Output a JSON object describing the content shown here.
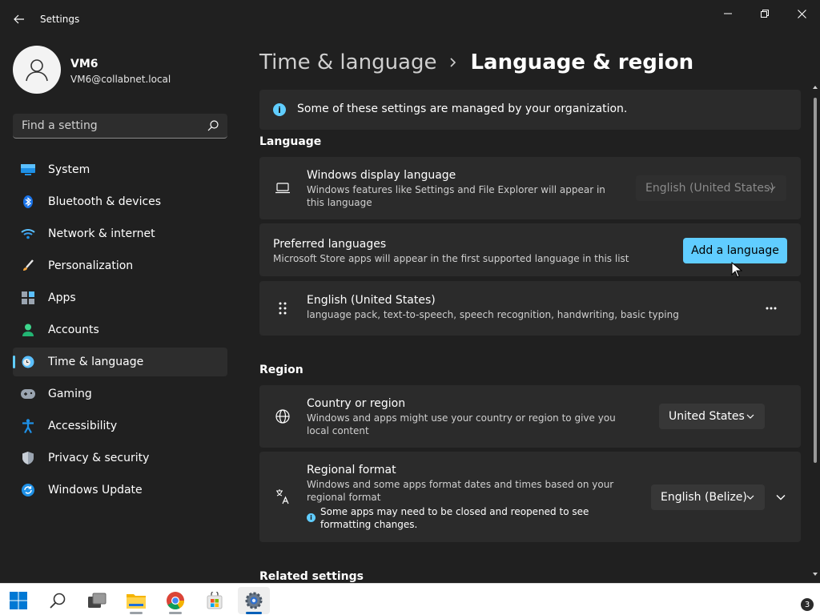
{
  "window": {
    "title": "Settings"
  },
  "profile": {
    "name": "VM6",
    "email": "VM6@collabnet.local"
  },
  "search": {
    "placeholder": "Find a setting",
    "value": ""
  },
  "sidebar": {
    "items": [
      {
        "label": "System",
        "icon": "monitor-icon"
      },
      {
        "label": "Bluetooth & devices",
        "icon": "bluetooth-icon"
      },
      {
        "label": "Network & internet",
        "icon": "wifi-icon"
      },
      {
        "label": "Personalization",
        "icon": "brush-icon"
      },
      {
        "label": "Apps",
        "icon": "apps-icon"
      },
      {
        "label": "Accounts",
        "icon": "person-icon"
      },
      {
        "label": "Time & language",
        "icon": "clock-globe-icon",
        "selected": true
      },
      {
        "label": "Gaming",
        "icon": "gamepad-icon"
      },
      {
        "label": "Accessibility",
        "icon": "accessibility-icon"
      },
      {
        "label": "Privacy & security",
        "icon": "shield-icon"
      },
      {
        "label": "Windows Update",
        "icon": "update-icon"
      }
    ]
  },
  "breadcrumb": {
    "parent": "Time & language",
    "current": "Language & region"
  },
  "info": {
    "text": "Some of these settings are managed by your organization."
  },
  "language": {
    "section_title": "Language",
    "display_language": {
      "title": "Windows display language",
      "description": "Windows features like Settings and File Explorer will appear in this language",
      "value": "English (United States)"
    },
    "preferred": {
      "title": "Preferred languages",
      "description": "Microsoft Store apps will appear in the first supported language in this list",
      "button": "Add a language"
    },
    "installed": {
      "title": "English (United States)",
      "description": "language pack, text-to-speech, speech recognition, handwriting, basic typing",
      "more": "..."
    }
  },
  "region": {
    "section_title": "Region",
    "country": {
      "title": "Country or region",
      "description": "Windows and apps might use your country or region to give you local content",
      "value": "United States"
    },
    "format": {
      "title": "Regional format",
      "description": "Windows and some apps format dates and times based on your regional format",
      "note": "Some apps may need to be closed and reopened to see formatting changes.",
      "value": "English (Belize)"
    }
  },
  "related": {
    "title": "Related settings"
  },
  "taskbar": {
    "items": [
      "windows-start-icon",
      "search-icon",
      "task-view-icon",
      "file-explorer-icon",
      "chrome-icon",
      "store-icon",
      "settings-icon"
    ],
    "badge": "3"
  },
  "colors": {
    "accent": "#60cdff",
    "background": "#202020",
    "card": "#2b2b2b"
  }
}
